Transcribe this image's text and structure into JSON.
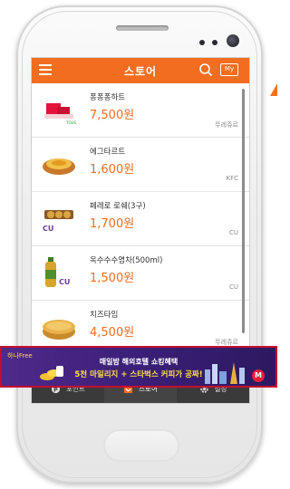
{
  "header": {
    "title": "스토어",
    "my_label": "My"
  },
  "products": [
    {
      "name": "퐁퐁퐁하트",
      "price": "7,500원",
      "brand": "뚜레쥬르",
      "icon": "strawberry-cake-image"
    },
    {
      "name": "에그타르트",
      "price": "1,600원",
      "brand": "KFC",
      "icon": "egg-tart-image"
    },
    {
      "name": "페레로 로쉐(3구)",
      "price": "1,700원",
      "brand": "CU",
      "icon": "ferrero-rocher-image"
    },
    {
      "name": "옥수수수염차(500ml)",
      "price": "1,500원",
      "brand": "CU",
      "icon": "corn-tea-bottle-image"
    },
    {
      "name": "치즈타임",
      "price": "4,500원",
      "brand": "뚜레쥬르",
      "icon": "cheese-cake-image"
    }
  ],
  "ad": {
    "logo": "하나Free",
    "line1": "매일밤 해외호텔 쇼킹혜택",
    "line2": "5천 마일리지 + 스타벅스 커피가 공짜!",
    "badge": "M"
  },
  "nav": {
    "items": [
      {
        "label": "포인트",
        "icon": "point-icon"
      },
      {
        "label": "스토어",
        "icon": "store-icon"
      },
      {
        "label": "설정",
        "icon": "gear-icon"
      }
    ]
  },
  "colors": {
    "accent": "#f26d1f",
    "nav_bg": "#3a3a3a",
    "ad_border": "#c40f2e"
  }
}
